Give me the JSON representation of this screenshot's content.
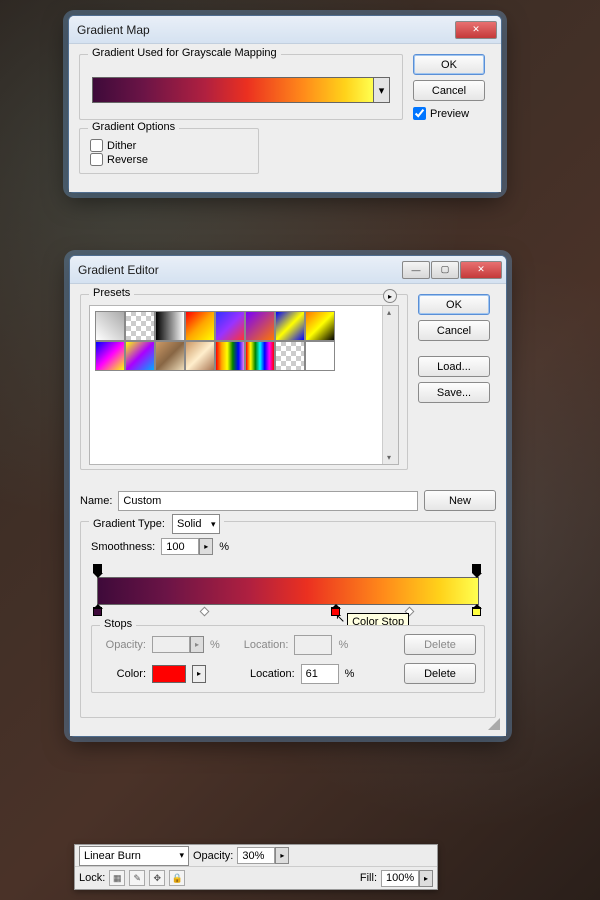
{
  "gmap": {
    "title": "Gradient Map",
    "fs_mapping": "Gradient Used for Grayscale Mapping",
    "fs_options": "Gradient Options",
    "dither": "Dither",
    "reverse": "Reverse",
    "ok": "OK",
    "cancel": "Cancel",
    "preview": "Preview"
  },
  "ged": {
    "title": "Gradient Editor",
    "presets": "Presets",
    "name_label": "Name:",
    "name_value": "Custom",
    "new": "New",
    "ok": "OK",
    "cancel": "Cancel",
    "load": "Load...",
    "save": "Save...",
    "type_label": "Gradient Type:",
    "type_value": "Solid",
    "smooth_label": "Smoothness:",
    "smooth_value": "100",
    "pct": "%",
    "stops": "Stops",
    "opacity_label": "Opacity:",
    "location_label": "Location:",
    "color_label": "Color:",
    "loc_value": "61",
    "delete": "Delete",
    "tooltip": "Color Stop",
    "color_stop_color": "#ff0000"
  },
  "layer": {
    "blend": "Linear Burn",
    "opacity_label": "Opacity:",
    "opacity_value": "30%",
    "lock_label": "Lock:",
    "fill_label": "Fill:",
    "fill_value": "100%"
  }
}
